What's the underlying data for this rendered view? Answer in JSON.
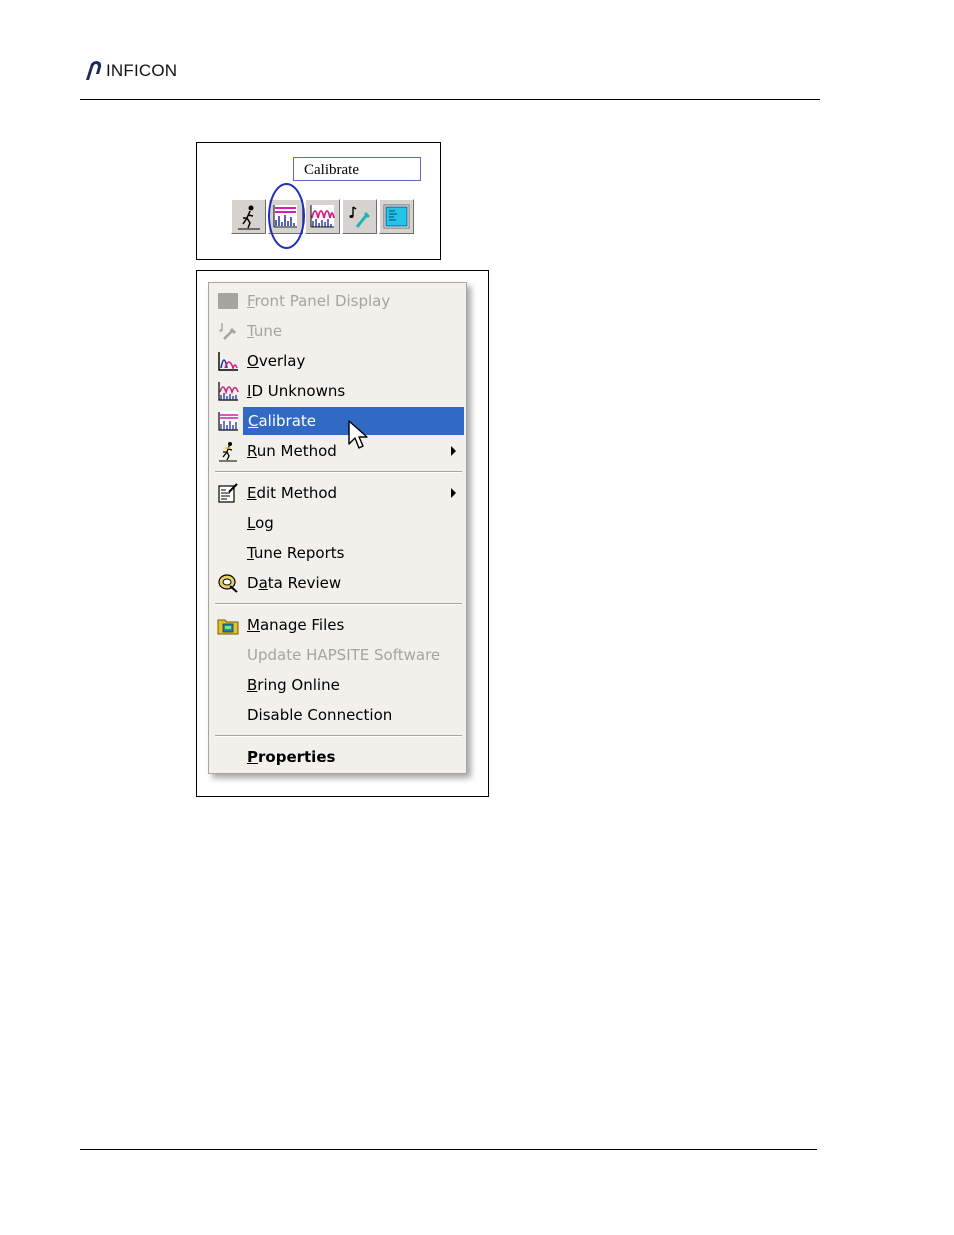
{
  "header": {
    "logo_text": "INFICON"
  },
  "figure_toolbar": {
    "tooltip": "Calibrate",
    "buttons": [
      {
        "icon": "run-method-icon"
      },
      {
        "icon": "calibrate-icon",
        "highlighted": true
      },
      {
        "icon": "id-unknowns-icon"
      },
      {
        "icon": "tune-icon"
      },
      {
        "icon": "front-panel-display-icon"
      }
    ],
    "highlight_color": "#1f2fbf"
  },
  "context_menu": {
    "items": [
      {
        "label": "Front Panel Display",
        "accelerator": "F",
        "enabled": false,
        "icon": "front-panel-display-icon"
      },
      {
        "label": "Tune",
        "accelerator": "T",
        "enabled": false,
        "icon": "tune-icon"
      },
      {
        "label": "Overlay",
        "accelerator": "O",
        "enabled": true,
        "icon": "overlay-icon"
      },
      {
        "label": "ID Unknowns",
        "accelerator": "I",
        "enabled": true,
        "icon": "id-unknowns-icon"
      },
      {
        "label": "Calibrate",
        "accelerator": "C",
        "enabled": true,
        "selected": true,
        "icon": "calibrate-icon"
      },
      {
        "label": "Run Method",
        "accelerator": "R",
        "enabled": true,
        "submenu": true,
        "icon": "run-method-icon"
      },
      {
        "label": "Edit Method",
        "accelerator": "E",
        "enabled": true,
        "submenu": true,
        "icon": "edit-method-icon"
      },
      {
        "label": "Log",
        "accelerator": "L",
        "enabled": true
      },
      {
        "label": "Tune Reports",
        "accelerator": "T",
        "enabled": true
      },
      {
        "label": "Data Review",
        "accelerator": "a",
        "enabled": true,
        "icon": "data-review-icon"
      },
      {
        "label": "Manage Files",
        "accelerator": "M",
        "enabled": true,
        "icon": "manage-files-icon"
      },
      {
        "label": "Update HAPSITE Software",
        "enabled": false
      },
      {
        "label": "Bring Online",
        "accelerator": "B",
        "enabled": true
      },
      {
        "label": "Disable Connection",
        "enabled": true
      },
      {
        "label": "Properties",
        "accelerator": "P",
        "enabled": true,
        "bold": true
      }
    ],
    "selection_color": "#316ac5"
  }
}
